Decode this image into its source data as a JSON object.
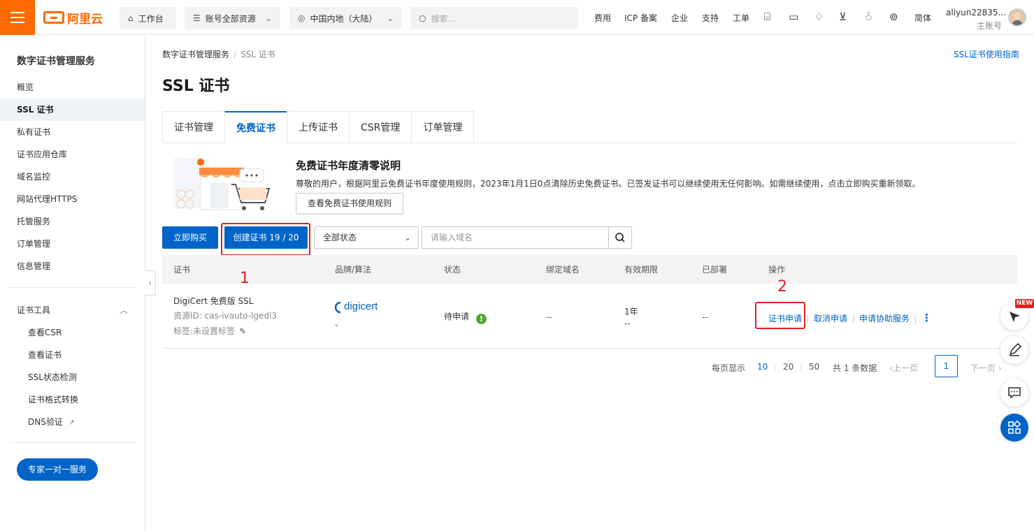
{
  "header": {
    "brand": "阿里云",
    "workbench": "工作台",
    "account_resources": "账号全部资源",
    "region": "中国内地（大陆）",
    "search_placeholder": "搜索...",
    "links": [
      "费用",
      "ICP 备案",
      "企业",
      "支持",
      "工单"
    ],
    "lang": "简体",
    "username": "aliyun22835...",
    "account_type": "主账号"
  },
  "sidebar": {
    "title": "数字证书管理服务",
    "items": [
      "概览",
      "SSL 证书",
      "私有证书",
      "证书应用仓库",
      "域名监控",
      "网站代理HTTPS",
      "托管服务",
      "订单管理",
      "信息管理"
    ],
    "active_index": 1,
    "tools_title": "证书工具",
    "tools": [
      "查看CSR",
      "查看证书",
      "SSL状态检测",
      "证书格式转换",
      "DNS验证"
    ],
    "expert_button": "专家一对一服务"
  },
  "breadcrumb": {
    "parent": "数字证书管理服务",
    "current": "SSL 证书"
  },
  "guide_link": "SSL证书使用指南",
  "page_title": "SSL 证书",
  "tabs": [
    "证书管理",
    "免费证书",
    "上传证书",
    "CSR管理",
    "订单管理"
  ],
  "active_tab": 1,
  "banner": {
    "title": "免费证书年度清零说明",
    "description": "尊敬的用户，根据阿里云免费证书年度使用规则，2023年1月1日0点清除历史免费证书。已签发证书可以继续使用无任何影响。如需继续使用，点击立即购买重新领取。",
    "button": "查看免费证书使用规则"
  },
  "toolbar": {
    "buy_button": "立即购买",
    "create_button": "创建证书 19 / 20",
    "status_select": "全部状态",
    "domain_placeholder": "请输入域名"
  },
  "table": {
    "headers": [
      "证书",
      "品牌/算法",
      "状态",
      "绑定域名",
      "有效期限",
      "已部署",
      "操作"
    ],
    "rows": [
      {
        "name": "DigiCert 免费版 SSL",
        "resource_id": "资源ID: cas-ivauto-lgedl3",
        "tags": "标签:未设置标签",
        "brand": "digicert",
        "algorithm": "-",
        "status": "待申请",
        "domain": "--",
        "validity": "1年",
        "validity_sub": "--",
        "deployed": "--",
        "actions": [
          "证书申请",
          "取消申请",
          "申请协助服务"
        ]
      }
    ]
  },
  "pagination": {
    "per_page_label": "每页显示",
    "sizes": [
      "10",
      "20",
      "50"
    ],
    "total": "共 1 条数据",
    "prev": "上一页",
    "current": "1",
    "next": "下一页"
  },
  "annotations": [
    "1",
    "2"
  ],
  "float_badge": "NEW",
  "colors": {
    "brand": "#ff6a00",
    "primary": "#0064c8",
    "highlight": "#e02020",
    "success": "#52a632"
  }
}
